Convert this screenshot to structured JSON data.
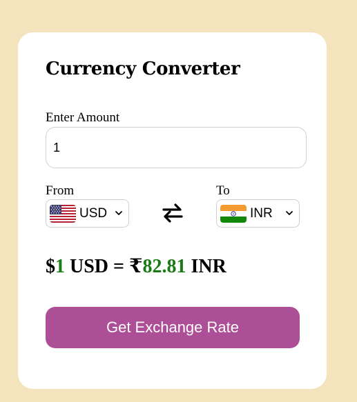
{
  "app": {
    "title": "Currency Converter"
  },
  "amount": {
    "label": "Enter Amount",
    "value": "1"
  },
  "from": {
    "label": "From",
    "currency": "USD",
    "flag": "us-flag-icon"
  },
  "to": {
    "label": "To",
    "currency": "INR",
    "flag": "india-flag-icon"
  },
  "swap": {
    "icon": "swap-arrows-icon"
  },
  "result": {
    "from_symbol": "$",
    "from_amount": "1",
    "from_code": " USD = ",
    "to_symbol": "₹",
    "to_amount": "82.81",
    "to_code": " INR"
  },
  "button": {
    "label": "Get Exchange Rate"
  },
  "colors": {
    "background": "#f3e4bd",
    "card": "#ffffff",
    "button": "#ad4f96",
    "result_number": "#1a7a16"
  }
}
